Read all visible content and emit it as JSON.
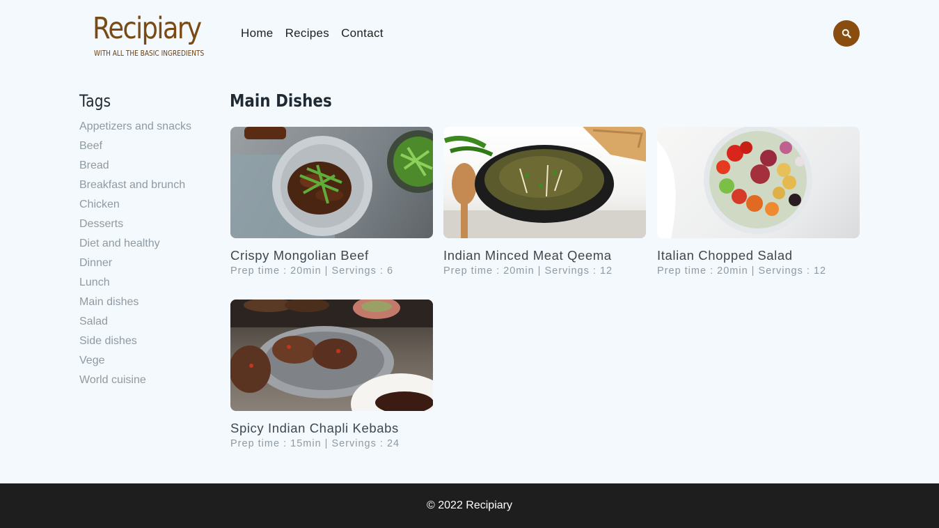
{
  "brand": {
    "name": "Recipiary",
    "tagline": "WITH ALL THE BASIC INGREDIENTS",
    "color": "#7a4a14"
  },
  "nav": {
    "items": [
      {
        "label": "Home"
      },
      {
        "label": "Recipes"
      },
      {
        "label": "Contact"
      }
    ],
    "search_icon": "search-icon",
    "search_color": "#8a4d10"
  },
  "sidebar": {
    "heading": "Tags",
    "tags": [
      {
        "label": "Appetizers and snacks"
      },
      {
        "label": "Beef"
      },
      {
        "label": "Bread"
      },
      {
        "label": "Breakfast and brunch"
      },
      {
        "label": "Chicken"
      },
      {
        "label": "Desserts"
      },
      {
        "label": "Diet and healthy"
      },
      {
        "label": "Dinner"
      },
      {
        "label": "Lunch"
      },
      {
        "label": "Main dishes"
      },
      {
        "label": "Salad"
      },
      {
        "label": "Side dishes"
      },
      {
        "label": "Vege"
      },
      {
        "label": "World cuisine"
      }
    ]
  },
  "main": {
    "heading": "Main Dishes",
    "recipes": [
      {
        "title": "Crispy Mongolian Beef",
        "meta": "Prep time : 20min | Servings : 6",
        "image": "mongolian-beef-photo"
      },
      {
        "title": "Indian Minced Meat Qeema",
        "meta": "Prep time : 20min | Servings : 12",
        "image": "qeema-photo"
      },
      {
        "title": "Italian Chopped Salad",
        "meta": "Prep time : 20min | Servings : 12",
        "image": "chopped-salad-photo"
      },
      {
        "title": "Spicy Indian Chapli Kebabs",
        "meta": "Prep time : 15min | Servings : 24",
        "image": "chapli-kebabs-photo"
      }
    ]
  },
  "footer": {
    "text": "© 2022 Recipiary"
  }
}
